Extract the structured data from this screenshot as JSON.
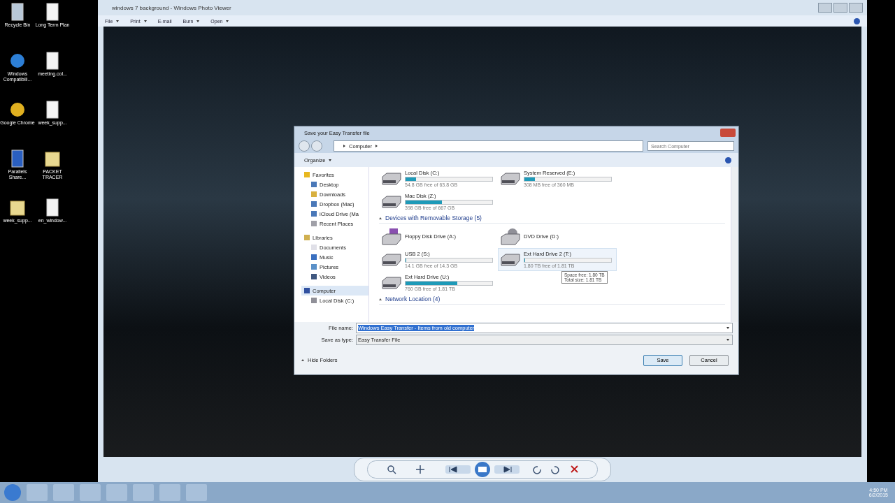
{
  "desktop_icons": [
    {
      "label": "Recycle Bin",
      "kind": "recycle"
    },
    {
      "label": "Long Term Plan",
      "kind": "chrome-doc"
    },
    {
      "label": "Windows Compatibili...",
      "kind": "browser"
    },
    {
      "label": "meeting.col...",
      "kind": "doc"
    },
    {
      "label": "Google Chrome",
      "kind": "chrome"
    },
    {
      "label": "week_supp...",
      "kind": "doc"
    },
    {
      "label": "Parallels Share...",
      "kind": "computer"
    },
    {
      "label": "PACKET TRACER",
      "kind": "folder"
    },
    {
      "label": "week_supp...",
      "kind": "folder"
    },
    {
      "label": "en_window...",
      "kind": "doc"
    }
  ],
  "viewer": {
    "title": "windows 7 background - Windows Photo Viewer",
    "menu": [
      "File",
      "Print",
      "E-mail",
      "Burn",
      "Open"
    ]
  },
  "dialog": {
    "title": "Save your Easy Transfer file",
    "breadcrumb": "Computer",
    "search_placeholder": "Search Computer",
    "organize": "Organize",
    "nav": [
      {
        "label": "Favorites",
        "kind": "star",
        "selected": false,
        "children": [
          {
            "label": "Desktop",
            "kind": "desktop",
            "selected": false
          },
          {
            "label": "Downloads",
            "kind": "downloads",
            "selected": false
          },
          {
            "label": "Dropbox (Mac)",
            "kind": "desktop",
            "selected": false
          },
          {
            "label": "iCloud Drive (Ma",
            "kind": "desktop",
            "selected": false
          },
          {
            "label": "Recent Places",
            "kind": "recent",
            "selected": false
          }
        ]
      },
      {
        "label": "Libraries",
        "kind": "library",
        "selected": false,
        "children": [
          {
            "label": "Documents",
            "kind": "doc",
            "selected": false
          },
          {
            "label": "Music",
            "kind": "music",
            "selected": false
          },
          {
            "label": "Pictures",
            "kind": "pictures",
            "selected": false
          },
          {
            "label": "Videos",
            "kind": "videos",
            "selected": false
          }
        ]
      },
      {
        "label": "Computer",
        "kind": "computer",
        "selected": true,
        "children": [
          {
            "label": "Local Disk (C:)",
            "kind": "disk",
            "selected": false
          }
        ]
      }
    ],
    "groups": [
      {
        "drives": [
          {
            "name": "Local Disk (C:)",
            "kind": "disk",
            "level": 0.12,
            "free": "54.8 GB free of 63.8 GB",
            "hovered": false
          },
          {
            "name": "System Reserved (E:)",
            "kind": "disk",
            "level": 0.12,
            "free": "308 MB free of 360 MB",
            "hovered": false
          },
          {
            "name": "Mac Disk (Z:)",
            "kind": "disk",
            "level": 0.42,
            "free": "398 GB free of 667 GB",
            "hovered": false
          }
        ]
      },
      {
        "title": "Devices with Removable Storage (5)",
        "drives": [
          {
            "name": "Floppy Disk Drive (A:)",
            "kind": "floppy",
            "hovered": false
          },
          {
            "name": "DVD Drive (D:)",
            "kind": "dvd",
            "hovered": false
          },
          {
            "name": "USB 2 (S:)",
            "kind": "disk",
            "level": 0.01,
            "free": "14.1 GB free of 14.3 GB",
            "hovered": false
          },
          {
            "name": "Ext Hard Drive 2 (T:)",
            "kind": "disk",
            "level": 0.01,
            "free": "1.80 TB free of 1.81 TB",
            "hovered": true
          },
          {
            "name": "Ext Hard Drive (U:)",
            "kind": "disk",
            "level": 0.6,
            "free": "760 GB free of 1.81 TB",
            "hovered": false
          }
        ]
      },
      {
        "title": "Network Location (4)"
      }
    ],
    "tooltip": [
      "Space free: 1.80 TB",
      "Total size: 1.81 TB"
    ],
    "file_name_label": "File name:",
    "file_name": "Windows Easy Transfer - Items from old computer",
    "type_label": "Save as type:",
    "type": "Easy Transfer File",
    "hide_folders": "Hide Folders",
    "buttons": [
      "Save",
      "Cancel"
    ]
  },
  "clock": {
    "time": "4:50 PM",
    "date": "6/2/2015"
  }
}
